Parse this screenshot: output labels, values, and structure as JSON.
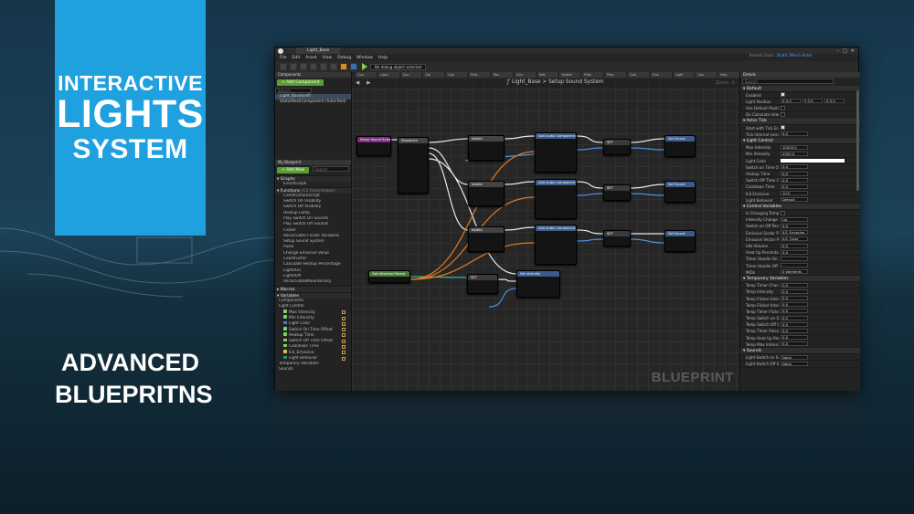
{
  "banner": {
    "line1": "INTERACTIVE",
    "line2": "LIGHTS",
    "line3": "SYSTEM",
    "color": "#1fa1e0"
  },
  "subtitle": {
    "line1": "ADVANCED",
    "line2": "BLUEPRITNS"
  },
  "editor": {
    "tab_title": "Light_Base",
    "menu": [
      "File",
      "Edit",
      "Asset",
      "View",
      "Debug",
      "Window",
      "Help"
    ],
    "parent_class_label": "Parent class:",
    "parent_class_value": "Static Mesh Actor",
    "debug_filter": "No debug object selected",
    "bp_tabs": [
      "Con",
      "Light",
      "Con",
      "Cal",
      "Con",
      "Puls",
      "Rec",
      "Con",
      "Setl",
      "Switch",
      "Play",
      "Play",
      "Calc",
      "Cha",
      "Light",
      "Con",
      "Hea"
    ],
    "breadcrumb": "Light_Base > Setup Sound System",
    "zoom": "Zoom -1",
    "watermark": "BLUEPRINT",
    "components": {
      "header": "Components",
      "add_button": "+ Add Component",
      "search_placeholder": "Search",
      "items": [
        "Light_Base(self)",
        "StaticMeshComponent (Inherited)"
      ]
    },
    "mybp": {
      "header": "My Blueprint",
      "add_button": "+ Add New",
      "search_placeholder": "Search",
      "graphs_label": "Graphs",
      "graph_items": [
        "EventGraph"
      ],
      "functions_label": "Functions",
      "functions_count": "(13 Overridable)",
      "function_items": [
        "ConstructionScript",
        "Switch On Visibility",
        "Switch Off Visibility",
        "Heatup Lamp",
        "Play Switch On Sounds",
        "Play Switch Off Sounds",
        "Flicker",
        "Recalculate Flicker Variables",
        "Setup Sound System",
        "Pulse",
        "Change Emissive Value",
        "Constructor",
        "Calculate Heatup Percentage",
        "LightsOn",
        "LightsOff",
        "RecalculateMaxIntensity"
      ],
      "macros_label": "Macros",
      "variables_label": "Variables",
      "var_groups": [
        "Components",
        "Light Control"
      ],
      "variables": [
        {
          "name": "Max Intensity",
          "color": "#7fd36a"
        },
        {
          "name": "Min Intensity",
          "color": "#7fd36a"
        },
        {
          "name": "Light Color",
          "color": "#4a7fe0"
        },
        {
          "name": "Switch On Time Offset",
          "color": "#7fd36a"
        },
        {
          "name": "Heatup Time",
          "color": "#7fd36a"
        },
        {
          "name": "Switch Off Time Offset",
          "color": "#7fd36a"
        },
        {
          "name": "Cooldown Time",
          "color": "#7fd36a"
        },
        {
          "name": "ILS_Emissive",
          "color": "#d9c24a"
        },
        {
          "name": "Light Behavior",
          "color": "#2f8f7a"
        }
      ],
      "extra_groups": [
        "Temporary Variables",
        "Sounds"
      ]
    },
    "details": {
      "header": "Details",
      "search_placeholder": "Search",
      "sections": [
        {
          "title": "Default",
          "rows": [
            {
              "label": "Enabled",
              "kind": "check",
              "value": true
            },
            {
              "label": "Light Position",
              "kind": "vec",
              "values": [
                "X 0.0",
                "Y 0.0",
                "Z 0.0"
              ]
            },
            {
              "label": "Use Default Position",
              "kind": "check",
              "value": false
            },
            {
              "label": "Do Calculate Intensity",
              "kind": "check",
              "value": false
            }
          ]
        },
        {
          "title": "Actor Tick",
          "rows": [
            {
              "label": "Start with Tick Enabled",
              "kind": "check",
              "value": true
            },
            {
              "label": "Tick Interval (secs)",
              "kind": "text",
              "value": "0.0"
            }
          ]
        },
        {
          "title": "Light Control",
          "rows": [
            {
              "label": "Max Intensity",
              "kind": "text",
              "value": "10000.0"
            },
            {
              "label": "Min Intensity",
              "kind": "text",
              "value": "2500.0"
            },
            {
              "label": "Light Color",
              "kind": "color",
              "value": "#ffffff"
            },
            {
              "label": "Switch on Time Offset",
              "kind": "text",
              "value": "0.0"
            },
            {
              "label": "Heatup Time",
              "kind": "text",
              "value": "0.0"
            },
            {
              "label": "Switch Off Time Offset",
              "kind": "text",
              "value": "0.0"
            },
            {
              "label": "Cooldown Time",
              "kind": "text",
              "value": "0.0"
            },
            {
              "label": "ILS Emissive",
              "kind": "text",
              "value": "10.0"
            },
            {
              "label": "Light Behavior",
              "kind": "text",
              "value": "Default"
            }
          ]
        },
        {
          "title": "Control Variables",
          "rows": [
            {
              "label": "Is Changing Temporal",
              "kind": "check",
              "value": false
            },
            {
              "label": "Intensity Change Type",
              "kind": "text",
              "value": "Up"
            },
            {
              "label": "Switch on Off Percent",
              "kind": "text",
              "value": "0.0"
            },
            {
              "label": "Emissive Scalar Para",
              "kind": "text",
              "value": "ILS_Emissive"
            },
            {
              "label": "Emissive Vector Para",
              "kind": "text",
              "value": "ILS_Color"
            },
            {
              "label": "Idle Volume",
              "kind": "text",
              "value": "0.0"
            },
            {
              "label": "Heat Up Percentage",
              "kind": "text",
              "value": "0.0"
            },
            {
              "label": "Timer Handle On",
              "kind": "text",
              "value": ""
            },
            {
              "label": "Timer Handle Off",
              "kind": "text",
              "value": ""
            },
            {
              "label": "MIDs",
              "kind": "text",
              "value": "0 elements"
            }
          ]
        },
        {
          "title": "Temporary Variables",
          "rows": [
            {
              "label": "Temp Timer Change I",
              "kind": "text",
              "value": "0.0"
            },
            {
              "label": "Temp Intensity",
              "kind": "text",
              "value": "0.0"
            },
            {
              "label": "Temp Flicker Interval",
              "kind": "text",
              "value": "0.0"
            },
            {
              "label": "Temp Flicker Intensity",
              "kind": "text",
              "value": "0.0"
            },
            {
              "label": "Temp Timer Flicker",
              "kind": "text",
              "value": "0.0"
            },
            {
              "label": "Temp Switch on Seco",
              "kind": "text",
              "value": "0.0"
            },
            {
              "label": "Temp Switch Off Seco",
              "kind": "text",
              "value": "0.0"
            },
            {
              "label": "Temp Timer Pulse",
              "kind": "text",
              "value": "0.0"
            },
            {
              "label": "Temp Heat Up Percen",
              "kind": "text",
              "value": "0.0"
            },
            {
              "label": "Temp Max Intensity",
              "kind": "text",
              "value": "0.0"
            }
          ]
        },
        {
          "title": "Sounds",
          "rows": [
            {
              "label": "Light Switch on Soun",
              "kind": "text",
              "value": "None"
            },
            {
              "label": "Light Switch Off Sour",
              "kind": "text",
              "value": "None"
            }
          ]
        }
      ]
    },
    "nodes": [
      {
        "title": "Setup Sound System",
        "color": "#7a2a82"
      },
      {
        "title": "Sequence",
        "color": "#444444"
      },
      {
        "title": "IsValid",
        "color": "#444444"
      },
      {
        "title": "Add Audio Component",
        "color": "#3b5b8a"
      },
      {
        "title": "SET",
        "color": "#3a3a3a"
      },
      {
        "title": "Set Sound",
        "color": "#3b5b8a"
      },
      {
        "title": "IsValid",
        "color": "#444444"
      },
      {
        "title": "Add Audio Component",
        "color": "#3b5b8a"
      },
      {
        "title": "SET",
        "color": "#3a3a3a"
      },
      {
        "title": "Set Sound",
        "color": "#3b5b8a"
      },
      {
        "title": "IsValid",
        "color": "#444444"
      },
      {
        "title": "Add Audio Component",
        "color": "#3b5b8a"
      },
      {
        "title": "SET",
        "color": "#3a3a3a"
      },
      {
        "title": "Set Sound",
        "color": "#3b5b8a"
      },
      {
        "title": "Get Attached Parent",
        "color": "#4a7a3a"
      },
      {
        "title": "SET",
        "color": "#3a3a3a"
      },
      {
        "title": "Set Visibility",
        "color": "#3b5b8a"
      }
    ]
  }
}
